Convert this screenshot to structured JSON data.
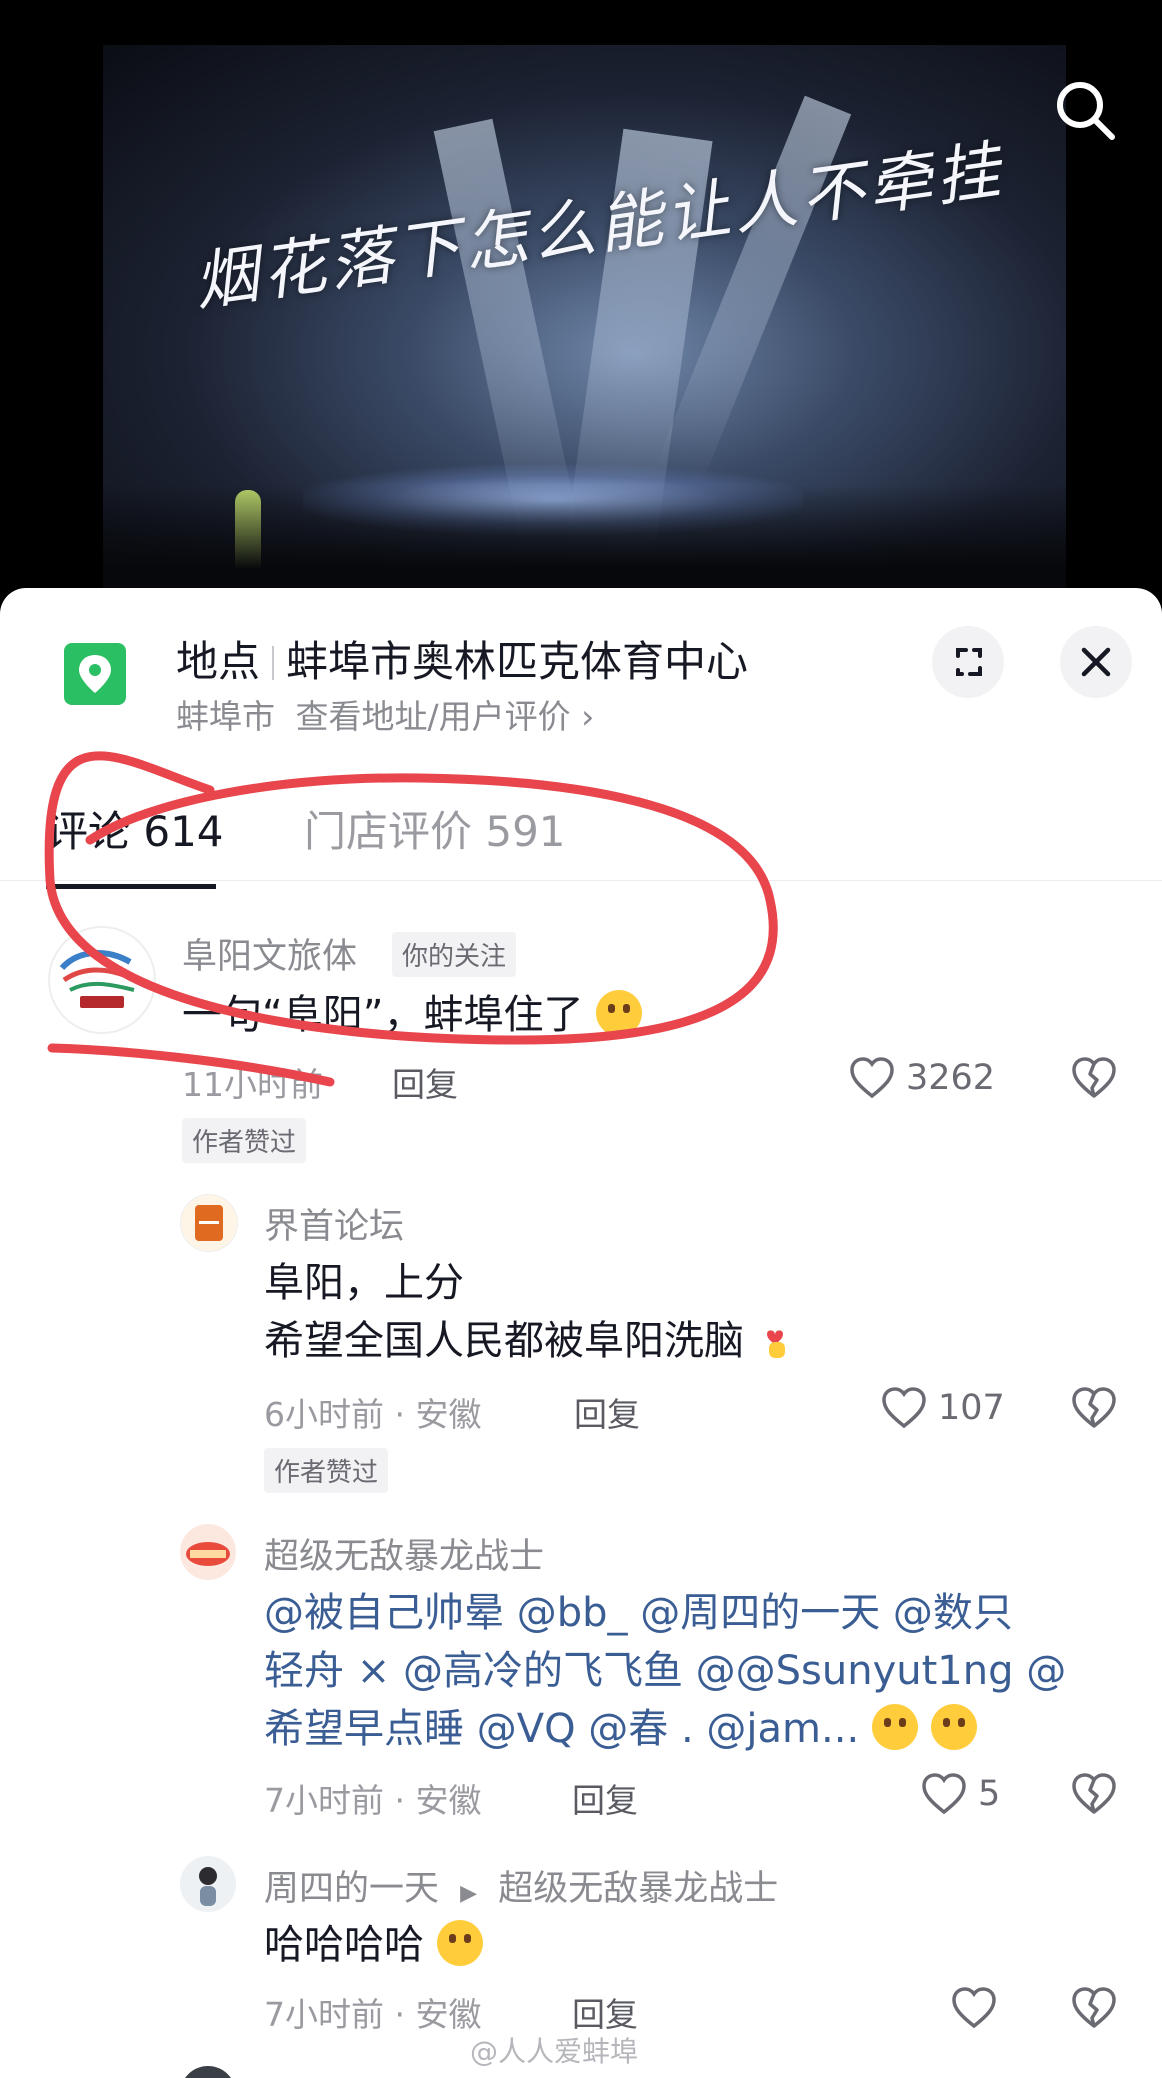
{
  "place": {
    "label": "地点",
    "name": "蚌埠市奥林匹克体育中心",
    "city": "蚌埠市",
    "detail_link": "查看地址/用户评价 ›"
  },
  "video": {
    "caption": "烟花落下怎么能让人不牵挂"
  },
  "tabs": [
    {
      "label": "评论 614",
      "active": true
    },
    {
      "label": "门店评价 591",
      "active": false
    }
  ],
  "comments": [
    {
      "user": "阜阳文旅体",
      "tag": "你的关注",
      "text": "一句“阜阳”，蚌埠住了",
      "time": "11小时前",
      "reply_label": "回复",
      "likes": "3262",
      "badge": "作者赞过"
    },
    {
      "user": "界首论坛",
      "text_lines": [
        "阜阳，上分",
        "希望全国人民都被阜阳洗脑"
      ],
      "time": "6小时前 · 安徽",
      "reply_label": "回复",
      "likes": "107",
      "badge": "作者赞过"
    },
    {
      "user": "超级无敌暴龙战士",
      "text_lines": [
        "@被自己帅晕 @bb_ @周四的一天 @数只",
        "轻舟 × @高冷的飞飞鱼 @@Ssunyut1ng @",
        "希望早点睡 @VQ @春 . @jam..."
      ],
      "time": "7小时前 · 安徽",
      "reply_label": "回复",
      "likes": "5"
    },
    {
      "user": "周四的一天",
      "reply_to": "超级无敌暴龙战士",
      "text": "哈哈哈哈",
      "time": "7小时前 · 安徽",
      "reply_label": "回复"
    }
  ],
  "watermark": "@人人爱蚌埠",
  "colors": {
    "accent_green": "#2bbf63",
    "annotation_red": "#e8464c",
    "mention_blue": "#3a5d94"
  }
}
